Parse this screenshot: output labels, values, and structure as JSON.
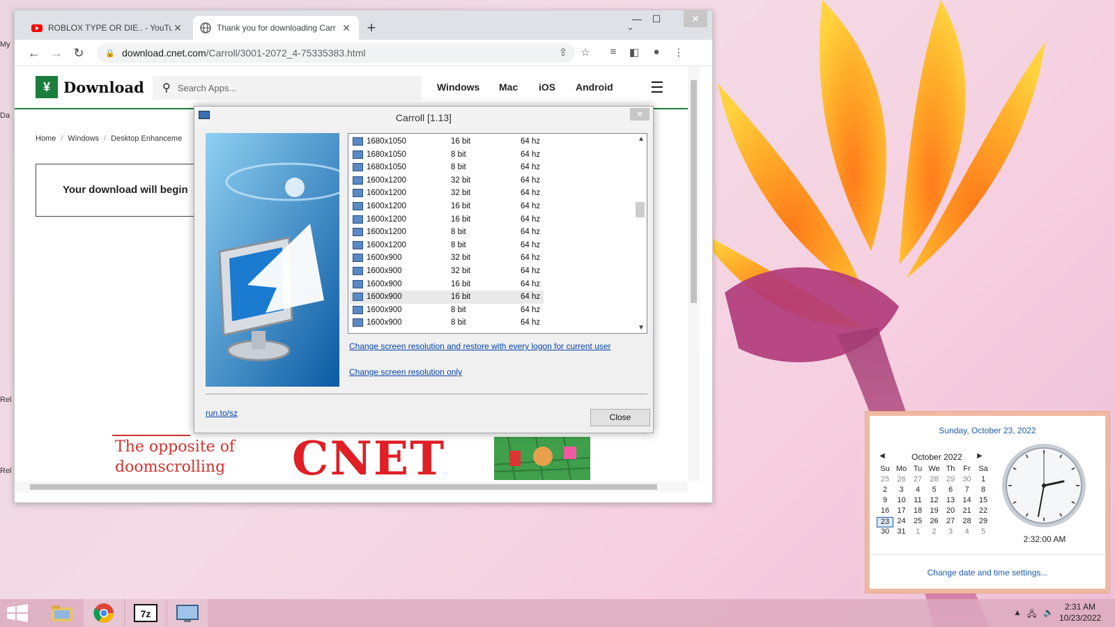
{
  "desktop": {
    "labels": [
      "My",
      "Da",
      "Rel",
      "Rel"
    ]
  },
  "browser": {
    "tabs": [
      {
        "title": "ROBLOX TYPE OR DIE.. - YouTube",
        "active": false
      },
      {
        "title": "Thank you for downloading Carr",
        "active": true
      }
    ],
    "new_tab": "+",
    "tab_menu": "⌄",
    "minimize": "—",
    "maximize": "☐",
    "close": "✕",
    "url_host": "download.cnet.com",
    "url_path": "/Carroll/3001-2072_4-75335383.html"
  },
  "site": {
    "logo": "Download",
    "search_placeholder": "Search Apps...",
    "nav": [
      "Windows",
      "Mac",
      "iOS",
      "Android"
    ],
    "breadcrumb": [
      "Home",
      "Windows",
      "Desktop Enhanceme"
    ],
    "download_message": "Your download will begin",
    "ad": {
      "line1": "The opposite of",
      "line2": "doomscrolling",
      "brand": "CNET"
    }
  },
  "dialog": {
    "title": "Carroll [1.13]",
    "close": "✕",
    "resolutions": [
      {
        "res": "1680x1050",
        "bit": "16 bit",
        "hz": "64 hz"
      },
      {
        "res": "1680x1050",
        "bit": "8 bit",
        "hz": "64 hz"
      },
      {
        "res": "1680x1050",
        "bit": "8 bit",
        "hz": "64 hz"
      },
      {
        "res": "1600x1200",
        "bit": "32 bit",
        "hz": "64 hz"
      },
      {
        "res": "1600x1200",
        "bit": "32 bit",
        "hz": "64 hz"
      },
      {
        "res": "1600x1200",
        "bit": "16 bit",
        "hz": "64 hz"
      },
      {
        "res": "1600x1200",
        "bit": "16 bit",
        "hz": "64 hz"
      },
      {
        "res": "1600x1200",
        "bit": "8 bit",
        "hz": "64 hz"
      },
      {
        "res": "1600x1200",
        "bit": "8 bit",
        "hz": "64 hz"
      },
      {
        "res": "1600x900",
        "bit": "32 bit",
        "hz": "64 hz"
      },
      {
        "res": "1600x900",
        "bit": "32 bit",
        "hz": "64 hz"
      },
      {
        "res": "1600x900",
        "bit": "16 bit",
        "hz": "64 hz"
      },
      {
        "res": "1600x900",
        "bit": "16 bit",
        "hz": "64 hz",
        "selected": true
      },
      {
        "res": "1600x900",
        "bit": "8 bit",
        "hz": "64 hz"
      },
      {
        "res": "1600x900",
        "bit": "8 bit",
        "hz": "64 hz"
      }
    ],
    "link_restore": "Change screen resolution and restore with every logon for current user",
    "link_only": "Change screen resolution only",
    "runto": "run.to/sz",
    "close_button": "Close"
  },
  "calendar": {
    "full_date": "Sunday, October 23, 2022",
    "month": "October 2022",
    "weekdays": [
      "Su",
      "Mo",
      "Tu",
      "We",
      "Th",
      "Fr",
      "Sa"
    ],
    "weeks": [
      [
        "25",
        "26",
        "27",
        "28",
        "29",
        "30",
        "1"
      ],
      [
        "2",
        "3",
        "4",
        "5",
        "6",
        "7",
        "8"
      ],
      [
        "9",
        "10",
        "11",
        "12",
        "13",
        "14",
        "15"
      ],
      [
        "16",
        "17",
        "18",
        "19",
        "20",
        "21",
        "22"
      ],
      [
        "23",
        "24",
        "25",
        "26",
        "27",
        "28",
        "29"
      ],
      [
        "30",
        "31",
        "1",
        "2",
        "3",
        "4",
        "5"
      ]
    ],
    "today": "23",
    "time": "2:32:00 AM",
    "settings_link": "Change date and time settings..."
  },
  "taskbar": {
    "time": "2:31 AM",
    "date": "10/23/2022",
    "apps": [
      "start",
      "file-explorer",
      "chrome",
      "7zip",
      "carroll"
    ]
  }
}
